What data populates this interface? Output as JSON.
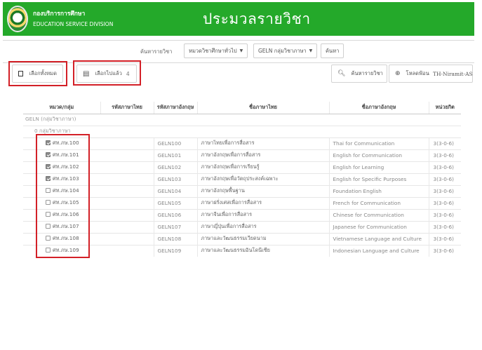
{
  "header": {
    "org_th": "กองบริการการศึกษา",
    "org_en": "EDUCATION SERVICE DIVISION",
    "title": "ประมวลรายวิชา",
    "bg_color": "#24a92a"
  },
  "search": {
    "label": "ค้นหารายวิชา",
    "category_select": "หมวดวิชาศึกษาทั่วไป",
    "group_select": "GELN กลุ่มวิชาภาษา",
    "search_button": "ค้นหา"
  },
  "actions": {
    "select_all": "เลือกทั้งหมด",
    "selected_label": "เลือกไปแล้ว",
    "selected_count": "4",
    "search_course": "ค้นหารายวิชา",
    "download": "โหลดฟ้อน",
    "font_name": "TH-Niramit-AS"
  },
  "table": {
    "headers": {
      "group": "หมวด/กลุ่ม",
      "code_th": "รหัสภาษาไทย",
      "code_en": "รหัสภาษาอังกฤษ",
      "name_th": "ชื่อภาษาไทย",
      "name_en": "ชื่อภาษาอังกฤษ",
      "credit": "หน่วยกิต"
    },
    "group_label": "GELN (กลุ่มวิชาภาษา)",
    "subgroup_label": "0 กลุ่มวิชาภาษา",
    "rows": [
      {
        "checked": true,
        "code_th": "ศท.ภษ.100",
        "code_en": "GELN100",
        "name_th": "ภาษาไทยเพื่อการสื่อสาร",
        "name_en": "Thai for Communication",
        "credit": "3(3-0-6)"
      },
      {
        "checked": true,
        "code_th": "ศท.ภษ.101",
        "code_en": "GELN101",
        "name_th": "ภาษาอังกฤษเพื่อการสื่อสาร",
        "name_en": "English for Communication",
        "credit": "3(3-0-6)"
      },
      {
        "checked": true,
        "code_th": "ศท.ภษ.102",
        "code_en": "GELN102",
        "name_th": "ภาษาอังกฤษเพื่อการเรียนรู้",
        "name_en": "English for Learning",
        "credit": "3(3-0-6)"
      },
      {
        "checked": true,
        "code_th": "ศท.ภษ.103",
        "code_en": "GELN103",
        "name_th": "ภาษาอังกฤษเพื่อวัตถุประสงค์เฉพาะ",
        "name_en": "English for Specific Purposes",
        "credit": "3(3-0-6)"
      },
      {
        "checked": false,
        "code_th": "ศท.ภษ.104",
        "code_en": "GELN104",
        "name_th": "ภาษาอังกฤษพื้นฐาน",
        "name_en": "Foundation English",
        "credit": "3(3-0-6)"
      },
      {
        "checked": false,
        "code_th": "ศท.ภษ.105",
        "code_en": "GELN105",
        "name_th": "ภาษาฝรั่งเศสเพื่อการสื่อสาร",
        "name_en": "French for Communication",
        "credit": "3(3-0-6)"
      },
      {
        "checked": false,
        "code_th": "ศท.ภษ.106",
        "code_en": "GELN106",
        "name_th": "ภาษาจีนเพื่อการสื่อสาร",
        "name_en": "Chinese for Communication",
        "credit": "3(3-0-6)"
      },
      {
        "checked": false,
        "code_th": "ศท.ภษ.107",
        "code_en": "GELN107",
        "name_th": "ภาษาญี่ปุ่นเพื่อการสื่อสาร",
        "name_en": "Japanese for Communication",
        "credit": "3(3-0-6)"
      },
      {
        "checked": false,
        "code_th": "ศท.ภษ.108",
        "code_en": "GELN108",
        "name_th": "ภาษาและวัฒนธรรมเวียดนาม",
        "name_en": "Vietnamese Language and Culture",
        "credit": "3(3-0-6)"
      },
      {
        "checked": false,
        "code_th": "ศท.ภษ.109",
        "code_en": "GELN109",
        "name_th": "ภาษาและวัฒนธรรมอินโดนีเซีย",
        "name_en": "Indonesian Language and Culture",
        "credit": "3(3-0-6)"
      }
    ]
  }
}
